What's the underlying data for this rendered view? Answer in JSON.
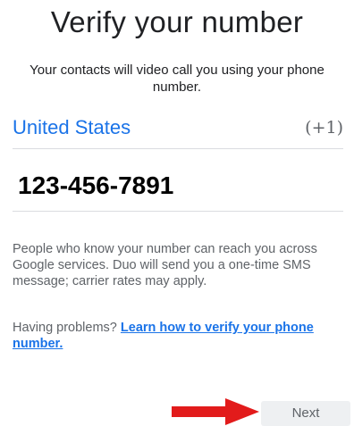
{
  "header": {
    "title": "Verify your number",
    "subtitle": "Your contacts will video call you using your phone number."
  },
  "country": {
    "name": "United States",
    "code": "(+1)"
  },
  "phone": {
    "value": "123-456-7891"
  },
  "info_text": "People who know your number can reach you across Google services. Duo will send you a one-time SMS message; carrier rates may apply.",
  "help": {
    "prefix": "Having problems?",
    "link_label": "Learn how to verify your phone number."
  },
  "actions": {
    "next_label": "Next"
  },
  "colors": {
    "accent": "#1a73e8",
    "annotation_arrow": "#e21b1b"
  },
  "annotation": {
    "arrow_icon": "red-arrow-pointing-right"
  }
}
